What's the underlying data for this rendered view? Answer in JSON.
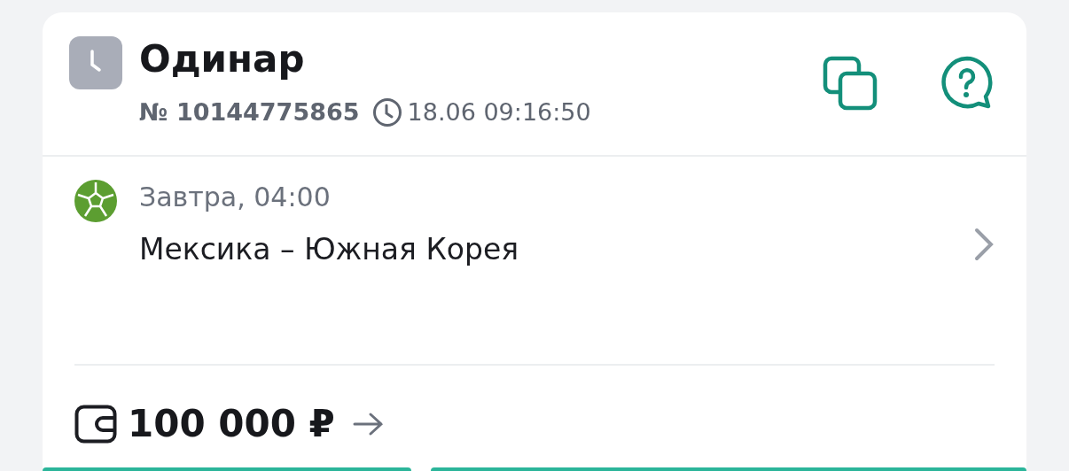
{
  "bet": {
    "title": "Одинар",
    "number": "№ 10144775865",
    "placed_at": "18.06 09:16:50"
  },
  "event": {
    "when": "Завтра, 04:00",
    "match": "Мексика – Южная Корея"
  },
  "stake": {
    "amount": "100 000 ₽"
  }
}
